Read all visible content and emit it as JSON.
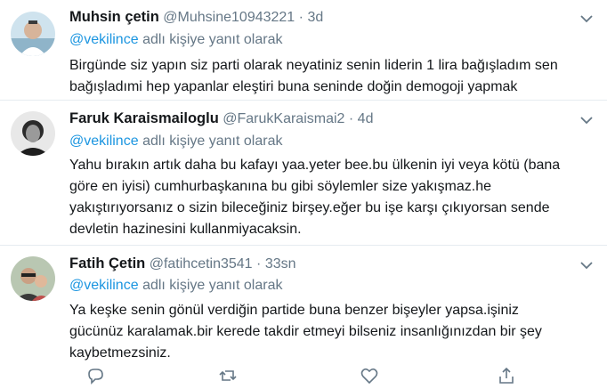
{
  "reply_prefix_suffix": "adlı kişiye yanıt olarak",
  "tweets": [
    {
      "name": "Muhsin çetin",
      "handle": "@Muhsine10943221",
      "dot": "·",
      "time": "3d",
      "mention": "@vekilince",
      "text": "Birgünde siz yapın siz parti olarak neyatiniz senin liderin 1 lira bağışladım sen bağışladımi hep yapanlar eleştiri buna seninde doğin demogoji yapmak",
      "more_icon": "chevron-down-icon"
    },
    {
      "name": "Faruk Karaismailoglu",
      "handle": "@FarukKaraismai2",
      "dot": "·",
      "time": "4d",
      "mention": "@vekilince",
      "text": "Yahu bırakın artık daha bu kafayı yaa.yeter bee.bu ülkenin iyi veya kötü (bana göre en iyisi) cumhurbaşkanına bu gibi söylemler size yakışmaz.he yakıştırıyorsanız o sizin bileceğiniz birşey.eğer bu işe karşı çıkıyorsan sende devletin hazinesini kullanmiyacaksin.",
      "more_icon": "chevron-down-icon"
    },
    {
      "name": "Fatih Çetin",
      "handle": "@fatihcetin3541",
      "dot": "·",
      "time": "33sn",
      "mention": "@vekilince",
      "text": "Ya keşke senin gönül verdiğin partide buna benzer bişeyler yapsa.işiniz gücünüz karalamak.bir kerede takdir etmeyi bilseniz insanlığınızdan bir şey kaybetmezsiniz.",
      "more_icon": "chevron-down-icon"
    }
  ],
  "action_icons": [
    "reply-icon",
    "retweet-icon",
    "like-icon",
    "share-icon"
  ],
  "colors": {
    "accent": "#1b95e0",
    "muted": "#657786",
    "text": "#14171a",
    "divider": "#e6ecf0"
  }
}
